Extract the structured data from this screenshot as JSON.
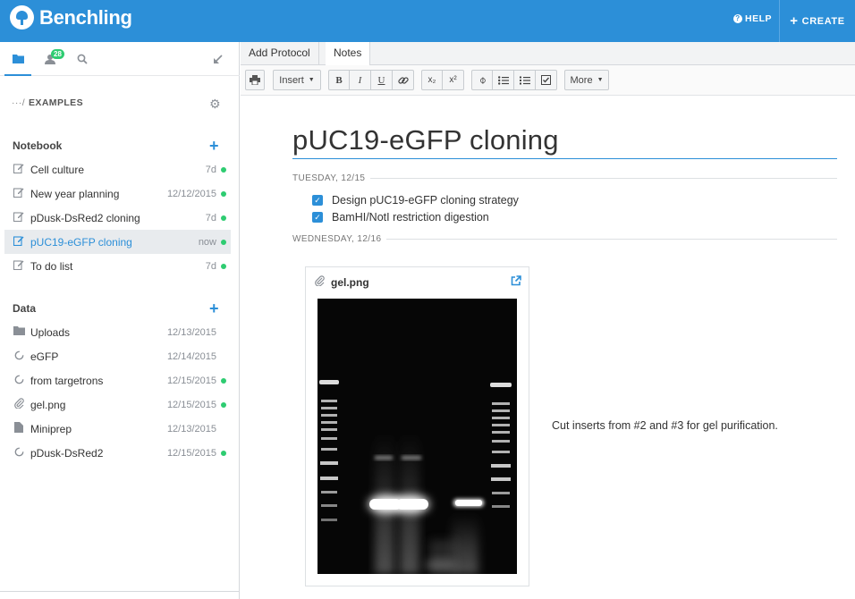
{
  "header": {
    "brand": "Benchling",
    "help": "HELP",
    "create": "CREATE"
  },
  "sidebar": {
    "badge_count": "28",
    "project": "EXAMPLES",
    "notebook_heading": "Notebook",
    "notebook_items": [
      {
        "label": "Cell culture",
        "date": "7d",
        "dot": true
      },
      {
        "label": "New year planning",
        "date": "12/12/2015",
        "dot": true
      },
      {
        "label": "pDusk-DsRed2 cloning",
        "date": "7d",
        "dot": true
      },
      {
        "label": "pUC19-eGFP cloning",
        "date": "now",
        "dot": true,
        "active": true
      },
      {
        "label": "To do list",
        "date": "7d",
        "dot": true
      }
    ],
    "data_heading": "Data",
    "data_items": [
      {
        "label": "Uploads",
        "date": "12/13/2015",
        "dot": false,
        "icon": "folder-icon"
      },
      {
        "label": "eGFP",
        "date": "12/14/2015",
        "dot": false,
        "icon": "sequence-icon"
      },
      {
        "label": "from targetrons",
        "date": "12/15/2015",
        "dot": true,
        "icon": "sequence-icon"
      },
      {
        "label": "gel.png",
        "date": "12/15/2015",
        "dot": true,
        "icon": "paperclip-icon"
      },
      {
        "label": "Miniprep",
        "date": "12/13/2015",
        "dot": false,
        "icon": "file-icon"
      },
      {
        "label": "pDusk-DsRed2",
        "date": "12/15/2015",
        "dot": true,
        "icon": "sequence-icon"
      }
    ]
  },
  "tabs": {
    "add_protocol": "Add Protocol",
    "notes": "Notes"
  },
  "toolbar": {
    "insert": "Insert",
    "bold": "B",
    "italic": "I",
    "underline": "U",
    "subscript": "x₂",
    "superscript": "x²",
    "more": "More"
  },
  "entry": {
    "title": "pUC19-eGFP cloning",
    "day1": "TUESDAY, 12/15",
    "tasks": [
      "Design pUC19-eGFP cloning strategy",
      "BamHI/NotI restriction digestion"
    ],
    "day2": "WEDNESDAY, 12/16",
    "attachment_name": "gel.png",
    "caption": "Cut inserts from #2 and #3 for gel purification."
  },
  "colors": {
    "accent": "#2c8fd8",
    "status_dot": "#2ecc71"
  }
}
